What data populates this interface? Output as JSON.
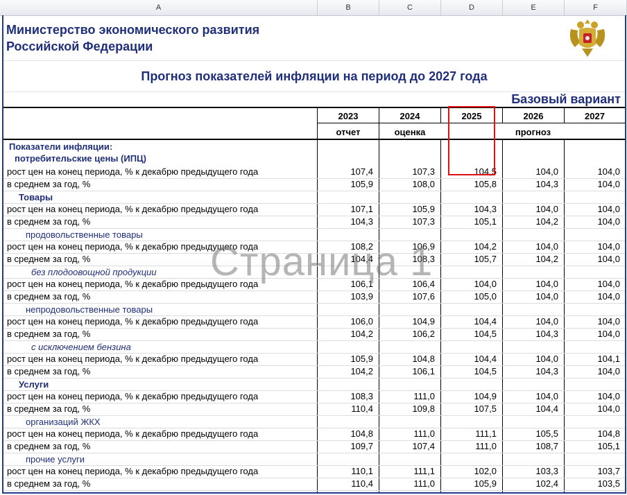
{
  "columns": [
    "A",
    "B",
    "C",
    "D",
    "E",
    "F"
  ],
  "header": {
    "ministry_line1": "Министерство экономического развития",
    "ministry_line2": "Российской Федерации",
    "title": "Прогноз показателей инфляции на период до 2027 года",
    "variant": "Базовый вариант",
    "emblem": "coat-of-arms-emblem"
  },
  "years": [
    "2023",
    "2024",
    "2025",
    "2026",
    "2027"
  ],
  "year_types": {
    "y2023": "отчет",
    "y2024": "оценка",
    "forecast": "прогноз"
  },
  "intro": {
    "line1": "Показатели инфляции:",
    "line2": "потребительские цены (ИПЦ)"
  },
  "labels": {
    "end": "рост цен на конец периода, % к декабрю предыдущего года",
    "avg": "в среднем за год, %"
  },
  "rows": [
    {
      "end": [
        "107,4",
        "107,3",
        "104,5",
        "104,0",
        "104,0"
      ],
      "avg": [
        "105,9",
        "108,0",
        "105,8",
        "104,3",
        "104,0"
      ]
    },
    {
      "title": "Товары",
      "style": "sect",
      "end": [
        "107,1",
        "105,9",
        "104,3",
        "104,0",
        "104,0"
      ],
      "avg": [
        "104,3",
        "107,3",
        "105,1",
        "104,2",
        "104,0"
      ]
    },
    {
      "title": "продовольственные товары",
      "style": "sub",
      "end": [
        "108,2",
        "106,9",
        "104,2",
        "104,0",
        "104,0"
      ],
      "avg": [
        "104,4",
        "108,3",
        "105,7",
        "104,2",
        "104,0"
      ]
    },
    {
      "title": "без плодоовощной  продукции",
      "style": "subi",
      "end": [
        "106,1",
        "106,4",
        "104,0",
        "104,0",
        "104,0"
      ],
      "avg": [
        "103,9",
        "107,6",
        "105,0",
        "104,0",
        "104,0"
      ]
    },
    {
      "title": "непродовольственные товары",
      "style": "sub",
      "end": [
        "106,0",
        "104,9",
        "104,4",
        "104,0",
        "104,0"
      ],
      "avg": [
        "104,2",
        "106,2",
        "104,5",
        "104,3",
        "104,0"
      ]
    },
    {
      "title": "с исключением бензина",
      "style": "subi",
      "end": [
        "105,9",
        "104,8",
        "104,4",
        "104,0",
        "104,1"
      ],
      "avg": [
        "104,2",
        "106,1",
        "104,5",
        "104,3",
        "104,0"
      ]
    },
    {
      "title": "Услуги",
      "style": "sect",
      "end": [
        "108,3",
        "111,0",
        "104,9",
        "104,0",
        "104,0"
      ],
      "avg": [
        "110,4",
        "109,8",
        "107,5",
        "104,4",
        "104,0"
      ]
    },
    {
      "title": "организаций ЖКХ",
      "style": "sub",
      "end": [
        "104,8",
        "111,0",
        "111,1",
        "105,5",
        "104,8"
      ],
      "avg": [
        "109,7",
        "107,4",
        "111,0",
        "108,7",
        "105,1"
      ]
    },
    {
      "title": "прочие услуги",
      "style": "sub",
      "end": [
        "110,1",
        "111,1",
        "102,0",
        "103,3",
        "103,7"
      ],
      "avg": [
        "110,4",
        "111,0",
        "105,9",
        "102,4",
        "103,5"
      ]
    }
  ],
  "watermark": "Страница 1"
}
